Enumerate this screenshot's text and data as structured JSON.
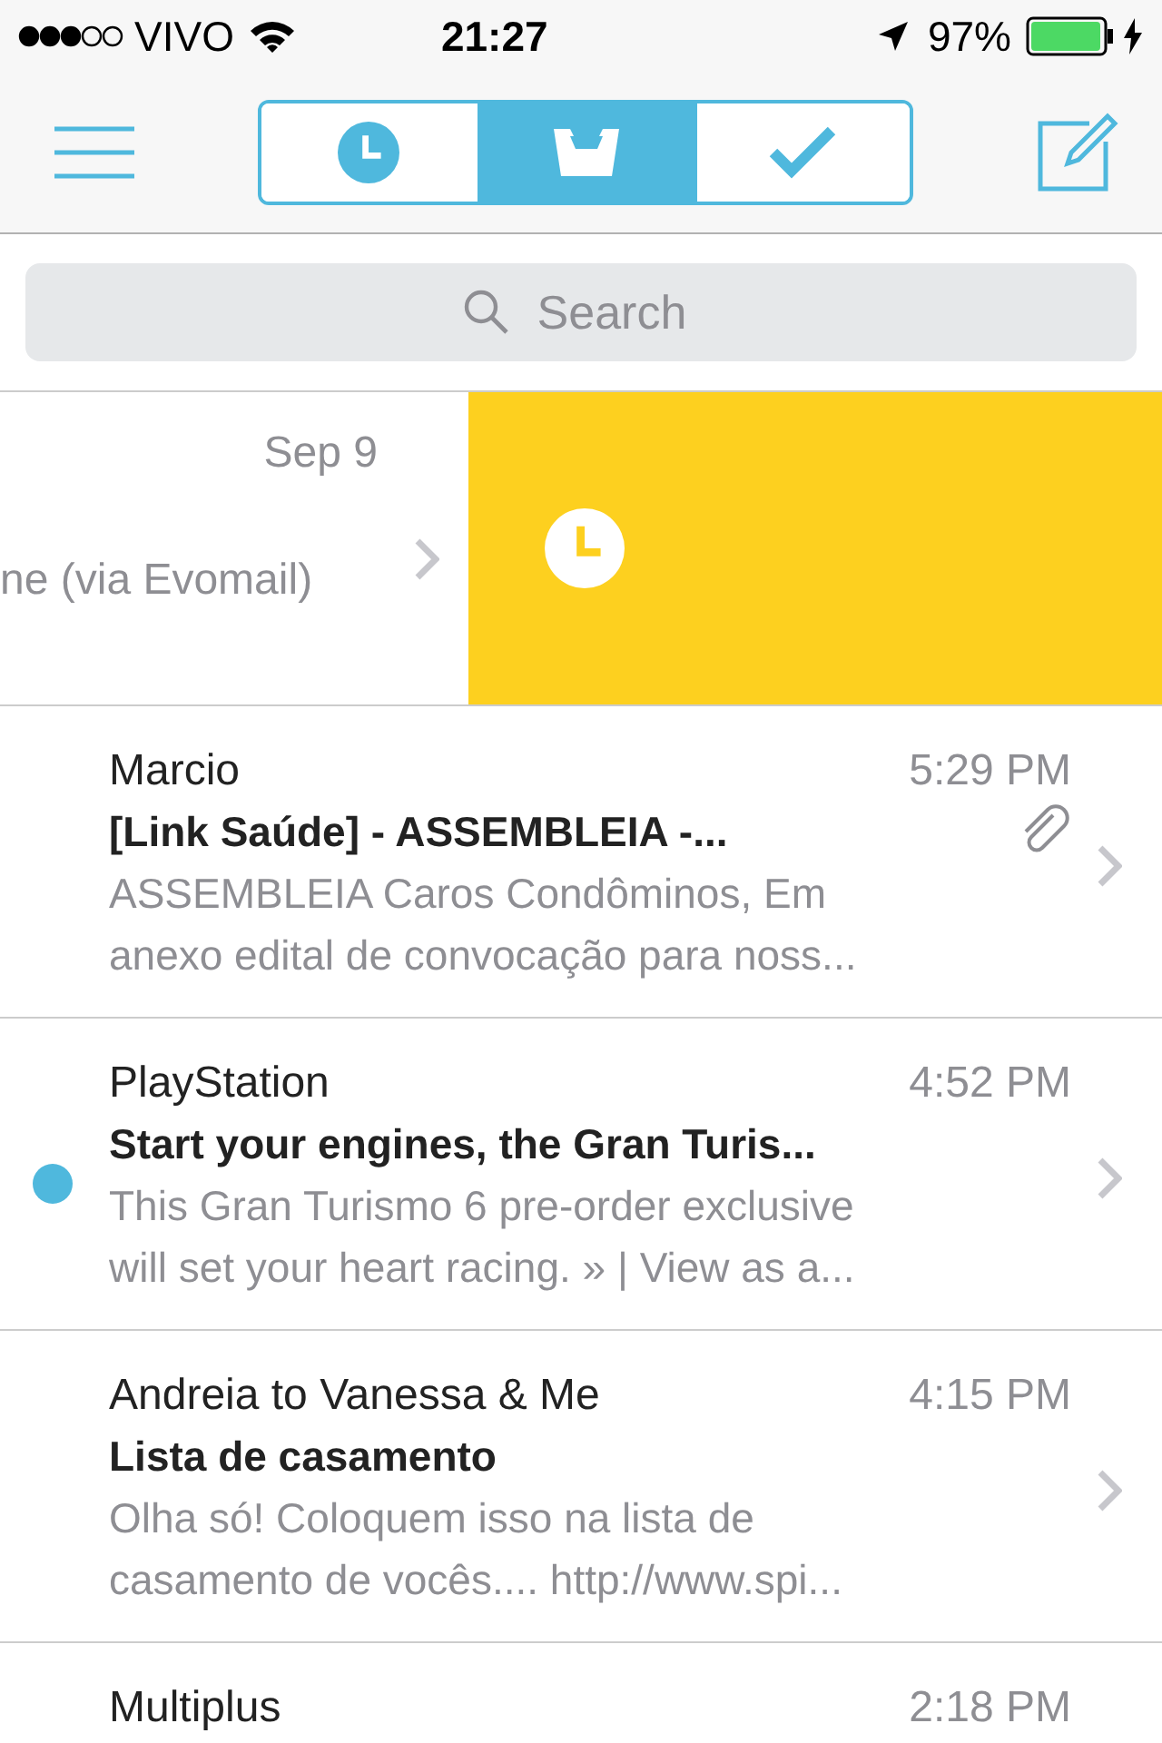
{
  "status_bar": {
    "carrier": "VIVO",
    "time": "21:27",
    "battery": "97%"
  },
  "toolbar": {
    "segments": [
      {
        "kind": "clock",
        "selected": false
      },
      {
        "kind": "inbox",
        "selected": true
      },
      {
        "kind": "check",
        "selected": false
      }
    ]
  },
  "search": {
    "placeholder": "Search"
  },
  "swiped_row": {
    "date": "Sep 9",
    "sender": "ne (via Evomail)",
    "action": {
      "kind": "later",
      "color": "#fdd01f"
    }
  },
  "messages": [
    {
      "sender": "Marcio",
      "time": "5:29 PM",
      "subject": "[Link Saúde] - ASSEMBLEIA -...",
      "attachment": true,
      "unread": false,
      "preview": [
        "ASSEMBLEIA Caros Condôminos, Em",
        "anexo edital de convocação para noss..."
      ]
    },
    {
      "sender": "PlayStation",
      "time": "4:52 PM",
      "subject": "Start your engines, the Gran Turis...",
      "attachment": false,
      "unread": true,
      "preview": [
        "This Gran Turismo 6 pre-order exclusive",
        "will set your heart racing. » | View as a..."
      ]
    },
    {
      "sender": "Andreia to Vanessa & Me",
      "time": "4:15 PM",
      "subject": "Lista de casamento",
      "attachment": false,
      "unread": false,
      "preview": [
        "Olha só! Coloquem isso na lista de",
        "casamento de vocês.... http://www.spi..."
      ]
    },
    {
      "sender": "Multiplus",
      "time": "2:18 PM"
    }
  ]
}
